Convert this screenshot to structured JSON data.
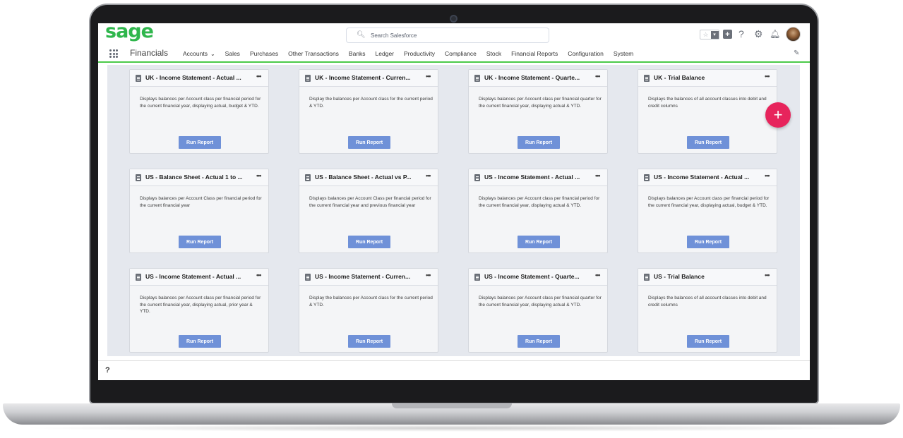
{
  "header": {
    "logo": "sage",
    "search_placeholder": "Search Salesforce",
    "utility_icons": [
      "star-icon",
      "chevron-down-icon",
      "plus-icon",
      "help-icon",
      "gear-icon",
      "bell-icon"
    ]
  },
  "nav": {
    "app_name": "Financials",
    "items": [
      {
        "label": "Accounts",
        "has_dropdown": true
      },
      {
        "label": "Sales"
      },
      {
        "label": "Purchases"
      },
      {
        "label": "Other Transactions"
      },
      {
        "label": "Banks"
      },
      {
        "label": "Ledger"
      },
      {
        "label": "Productivity"
      },
      {
        "label": "Compliance"
      },
      {
        "label": "Stock"
      },
      {
        "label": "Financial Reports"
      },
      {
        "label": "Configuration"
      },
      {
        "label": "System"
      }
    ]
  },
  "cards": [
    {
      "title": "UK - Income Statement - Actual ...",
      "description": "Displays balances per Account class per financial period for the current financial year, displaying actual, budget & YTD.",
      "button": "Run Report"
    },
    {
      "title": "UK - Income Statement - Curren...",
      "description": "Display the balances per Account class for the current period & YTD.",
      "button": "Run Report"
    },
    {
      "title": "UK - Income Statement - Quarte...",
      "description": "Displays balances per Account class per financial quarter for the current financial year, displaying actual & YTD.",
      "button": "Run Report"
    },
    {
      "title": "UK - Trial Balance",
      "description": "Displays the balances of all account classes into debit and credit columns",
      "button": "Run Report"
    },
    {
      "title": "US - Balance Sheet - Actual 1 to ...",
      "description": "Displays balances per Account Class per financial period for the current financial year",
      "button": "Run Report"
    },
    {
      "title": "US - Balance Sheet - Actual vs P...",
      "description": "Displays balances per Account Class per financial period for the current financial year and previous financial year",
      "button": "Run Report"
    },
    {
      "title": "US - Income Statement - Actual ...",
      "description": "Displays balances per Account class per financial period for the current financial year, displaying actual & YTD.",
      "button": "Run Report"
    },
    {
      "title": "US - Income Statement - Actual ...",
      "description": "Displays balances per Account class per financial period for the current financial year, displaying actual, budget & YTD.",
      "button": "Run Report"
    },
    {
      "title": "US - Income Statement - Actual ...",
      "description": "Displays balances per Account class per financial period for the current financial year, displaying actual, prior year & YTD.",
      "button": "Run Report"
    },
    {
      "title": "US - Income Statement - Curren...",
      "description": "Display the balances per Account class for the current period & YTD.",
      "button": "Run Report"
    },
    {
      "title": "US - Income Statement - Quarte...",
      "description": "Displays balances per Account class per financial quarter for the current financial year, displaying actual & YTD.",
      "button": "Run Report"
    },
    {
      "title": "US - Trial Balance",
      "description": "Displays the balances of all account classes into debit and credit columns",
      "button": "Run Report"
    }
  ],
  "fab_label": "+",
  "footer": {
    "help": "?"
  },
  "colors": {
    "brand": "#2fb64c",
    "nav_underline": "#4bca49",
    "run_button": "#6f91d8",
    "fab": "#e7245c"
  }
}
